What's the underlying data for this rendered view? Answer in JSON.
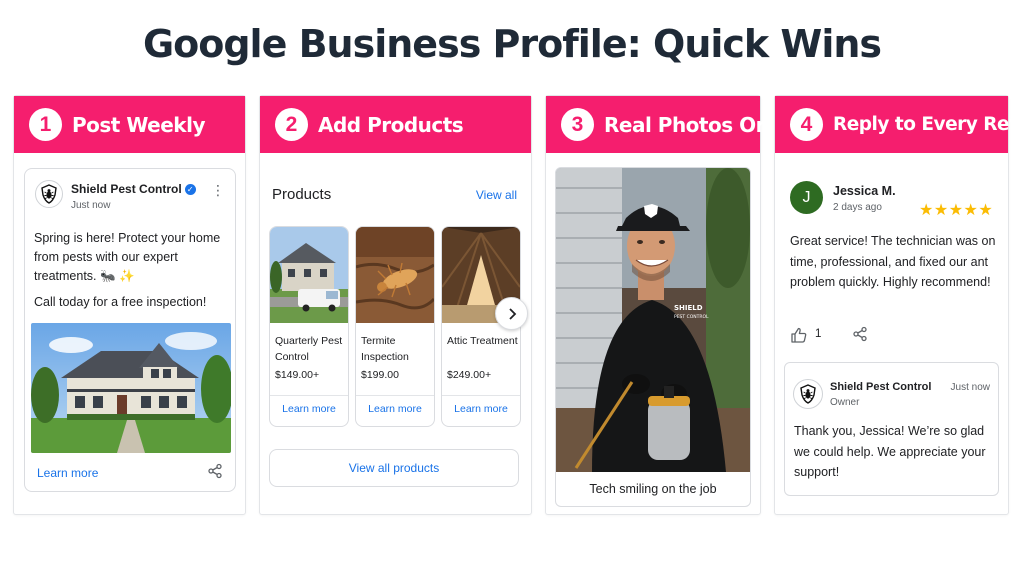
{
  "title": "Google Business Profile: Quick Wins",
  "brand_color": "#f51e6e",
  "link_color": "#1a73e8",
  "panels": [
    {
      "number": "1",
      "title": "Post Weekly"
    },
    {
      "number": "2",
      "title": "Add Products"
    },
    {
      "number": "3",
      "title": "Real Photos Only"
    },
    {
      "number": "4",
      "title": "Reply to Every Review"
    }
  ],
  "post": {
    "business_name": "Shield Pest Control",
    "verified_icon": "verified-badge-icon",
    "time": "Just now",
    "body": "Spring is here! Protect your home from pests with our expert treatments. 🐜 ✨",
    "cta": "Call today for a free inspection!",
    "link": "Learn more"
  },
  "products": {
    "heading": "Products",
    "view_all": "View all",
    "items": [
      {
        "name": "Quarterly Pest Control",
        "price": "$149.00+",
        "link": "Learn more"
      },
      {
        "name": "Termite Inspection",
        "price": "$199.00",
        "link": "Learn more"
      },
      {
        "name": "Attic Treatment",
        "price": "$249.00+",
        "link": "Learn more"
      }
    ],
    "view_all_button": "View all products"
  },
  "photo": {
    "shirt_text": "SHIELD PEST CONTROL",
    "caption": "Tech smiling on the job"
  },
  "review": {
    "avatar_letter": "J",
    "reviewer": "Jessica M.",
    "time": "2 days ago",
    "stars": "★★★★★",
    "rating": 5,
    "text": "Great service! The technician was on time, professional, and fixed our ant problem quickly. Highly recommend!",
    "likes": "1",
    "reply": {
      "name": "Shield Pest Control",
      "time": "Just now",
      "role": "Owner",
      "text": "Thank you, Jessica! We’re so glad we could help. We appreciate your support!"
    }
  }
}
